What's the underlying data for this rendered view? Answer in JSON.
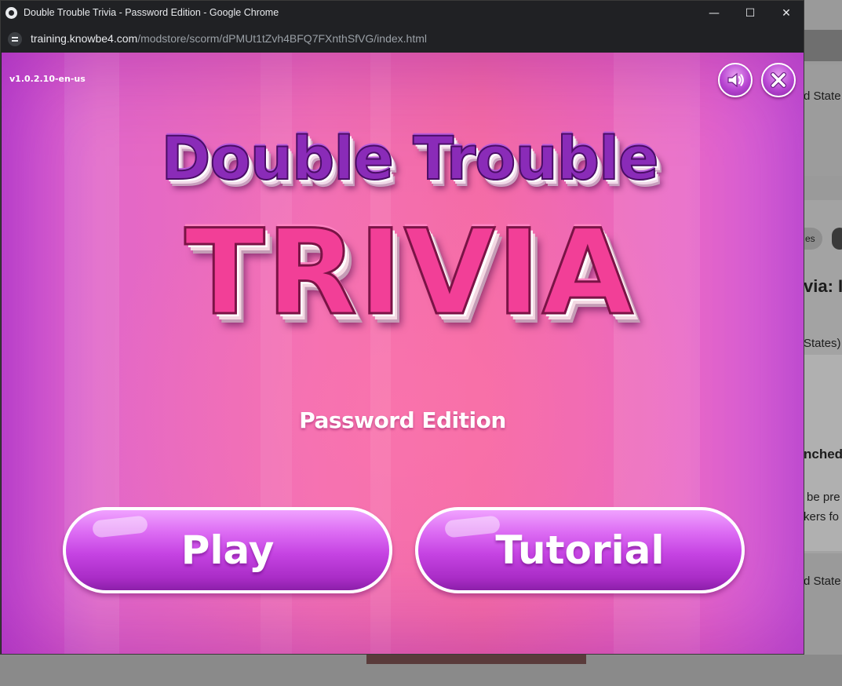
{
  "window": {
    "title": "Double Trouble Trivia - Password Edition - Google Chrome",
    "controls": {
      "minimize": "—",
      "maximize": "☐",
      "close": "✕"
    }
  },
  "address": {
    "host": "training.knowbe4.com",
    "path": "/modstore/scorm/dPMUt1tZvh4BFQ7FXnthSfVG/index.html"
  },
  "game": {
    "version": "v1.0.2.10-en-us",
    "logo_line1": "Double Trouble",
    "logo_line2": "TRIVIA",
    "subtitle": "Password Edition",
    "play_label": "Play",
    "tutorial_label": "Tutorial",
    "sound_icon": "speaker-icon",
    "close_icon": "close-icon"
  },
  "background_page": {
    "snippets": [
      "d State",
      "es",
      "via: I",
      "States)",
      "nched",
      "be pre",
      "kers fo",
      "d State"
    ]
  },
  "colors": {
    "accent_purple": "#b845d2",
    "logo_pink": "#f23f97",
    "logo_purple": "#8a2bb8"
  }
}
